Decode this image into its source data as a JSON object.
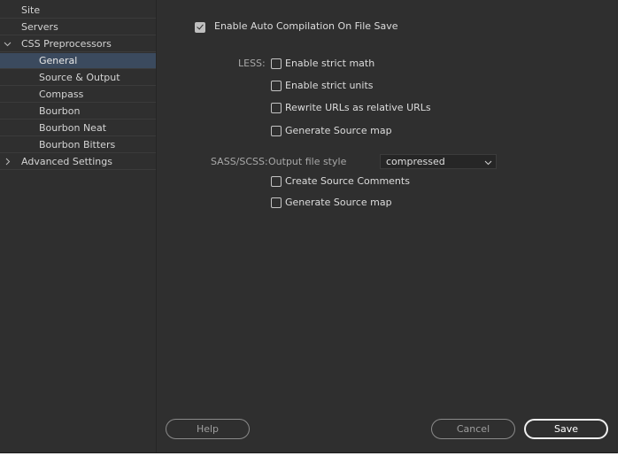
{
  "sidebar": {
    "items": [
      {
        "label": "Site"
      },
      {
        "label": "Servers"
      },
      {
        "label": "CSS Preprocessors"
      },
      {
        "label": "General"
      },
      {
        "label": "Source & Output"
      },
      {
        "label": "Compass"
      },
      {
        "label": "Bourbon"
      },
      {
        "label": "Bourbon Neat"
      },
      {
        "label": "Bourbon Bitters"
      },
      {
        "label": "Advanced Settings"
      }
    ]
  },
  "general": {
    "auto_compile": {
      "label": "Enable Auto Compilation On File Save",
      "checked": true
    },
    "less": {
      "section_label": "LESS:",
      "options": [
        {
          "label": "Enable strict math",
          "checked": false
        },
        {
          "label": "Enable strict units",
          "checked": false
        },
        {
          "label": "Rewrite URLs as relative URLs",
          "checked": false
        },
        {
          "label": "Generate Source map",
          "checked": false
        }
      ]
    },
    "sass": {
      "section_label": "SASS/SCSS:",
      "output_style_label": "Output file style",
      "output_style_value": "compressed",
      "options": [
        {
          "label": "Create Source Comments",
          "checked": false
        },
        {
          "label": "Generate Source map",
          "checked": false
        }
      ]
    }
  },
  "footer": {
    "help_label": "Help",
    "cancel_label": "Cancel",
    "save_label": "Save"
  },
  "colors": {
    "background": "#2f2f2f",
    "selected_row": "#3b4a5e",
    "text": "#d6d6d6"
  }
}
